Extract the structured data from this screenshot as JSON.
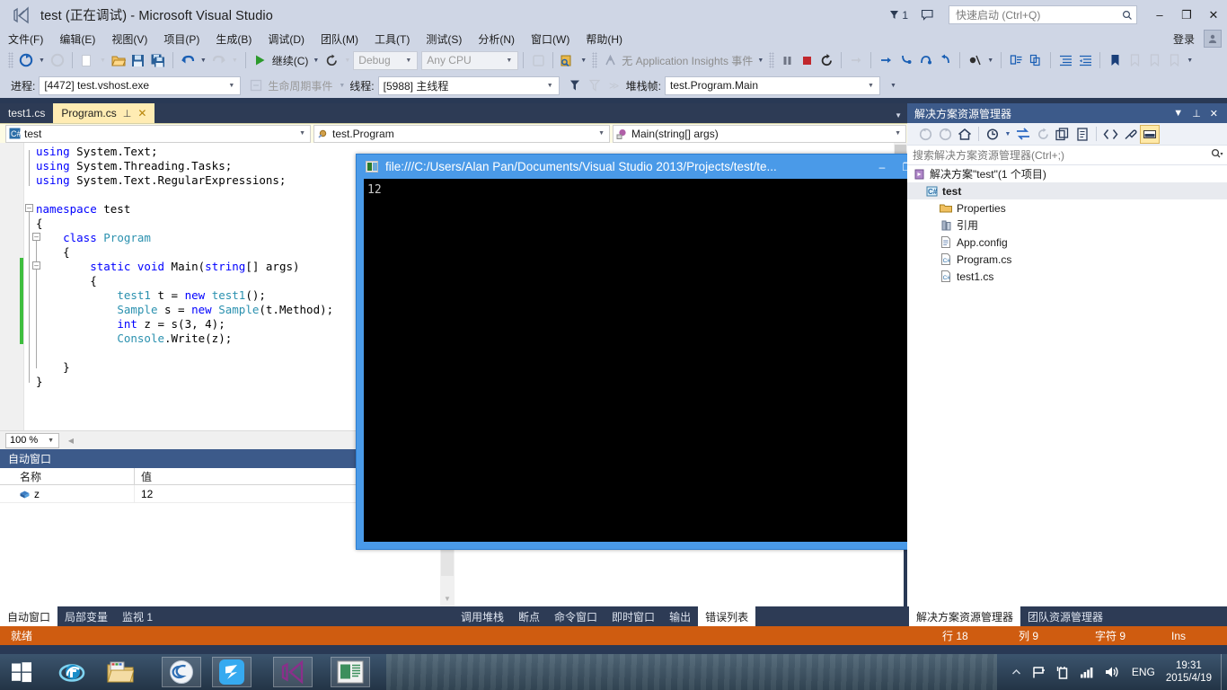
{
  "titlebar": {
    "app_icon": "visual-studio-logo",
    "title": "test (正在调试) - Microsoft Visual Studio",
    "notification_count": "1",
    "quick_launch_placeholder": "快速启动 (Ctrl+Q)",
    "minimize": "–",
    "restore": "❐",
    "close": "✕"
  },
  "menubar": {
    "items": [
      {
        "label": "文件(F)"
      },
      {
        "label": "编辑(E)"
      },
      {
        "label": "视图(V)"
      },
      {
        "label": "项目(P)"
      },
      {
        "label": "生成(B)"
      },
      {
        "label": "调试(D)"
      },
      {
        "label": "团队(M)"
      },
      {
        "label": "工具(T)"
      },
      {
        "label": "测试(S)"
      },
      {
        "label": "分析(N)"
      },
      {
        "label": "窗口(W)"
      },
      {
        "label": "帮助(H)"
      }
    ],
    "signin": "登录"
  },
  "toolbar": {
    "continue_label": "继续(C)",
    "config_value": "Debug",
    "platform_value": "Any CPU",
    "app_insights_label": "无 Application Insights 事件",
    "process_label": "进程:",
    "process_value": "[4472] test.vshost.exe",
    "lifecycle_label": "生命周期事件",
    "thread_label": "线程:",
    "thread_value": "[5988] 主线程",
    "stackframe_label": "堆栈帧:",
    "stackframe_value": "test.Program.Main"
  },
  "doctabs": {
    "tabs": [
      {
        "label": "test1.cs",
        "active": false
      },
      {
        "label": "Program.cs",
        "active": true
      }
    ],
    "pin_glyph": "⊥",
    "close_glyph": "✕"
  },
  "navbar": {
    "project": "test",
    "type": "test.Program",
    "member": "Main(string[] args)"
  },
  "editor": {
    "zoom": "100 %",
    "lines": [
      "using System.Text;",
      "using System.Threading.Tasks;",
      "using System.Text.RegularExpressions;",
      "",
      "namespace test",
      "{",
      "    class Program",
      "    {",
      "        static void Main(string[] args)",
      "        {",
      "            test1 t = new test1();",
      "            Sample s = new Sample(t.Method);",
      "            int z = s(3, 4);",
      "            Console.Write(z);",
      "        }",
      "    }",
      "}"
    ]
  },
  "autos": {
    "title": "自动窗口",
    "columns": [
      "名称",
      "值"
    ],
    "rows": [
      {
        "name": "z",
        "value": "12"
      }
    ]
  },
  "bottom_tabs": {
    "left": [
      {
        "label": "自动窗口",
        "active": true
      },
      {
        "label": "局部变量",
        "active": false
      },
      {
        "label": "监视 1",
        "active": false
      }
    ],
    "middle": [
      {
        "label": "调用堆栈",
        "active": false
      },
      {
        "label": "断点",
        "active": false
      },
      {
        "label": "命令窗口",
        "active": false
      },
      {
        "label": "即时窗口",
        "active": false
      },
      {
        "label": "输出",
        "active": false
      },
      {
        "label": "错误列表",
        "active": true
      }
    ],
    "right": [
      {
        "label": "解决方案资源管理器",
        "active": true
      },
      {
        "label": "团队资源管理器",
        "active": false
      }
    ]
  },
  "statusbar": {
    "ready": "就绪",
    "line": "行 18",
    "column": "列 9",
    "character": "字符 9",
    "insert_mode": "Ins"
  },
  "solution_explorer": {
    "title": "解决方案资源管理器",
    "search_placeholder": "搜索解决方案资源管理器(Ctrl+;)",
    "tree": [
      {
        "label": "解决方案\"test\"(1 个项目)",
        "indent": 0,
        "icon": "solution-icon",
        "selected": false
      },
      {
        "label": "test",
        "indent": 1,
        "icon": "project-icon",
        "selected": true,
        "bold": true
      },
      {
        "label": "Properties",
        "indent": 2,
        "icon": "folder-icon",
        "selected": false
      },
      {
        "label": "引用",
        "indent": 2,
        "icon": "references-icon",
        "selected": false
      },
      {
        "label": "App.config",
        "indent": 2,
        "icon": "config-file-icon",
        "selected": false
      },
      {
        "label": "Program.cs",
        "indent": 2,
        "icon": "csharp-file-icon",
        "selected": false
      },
      {
        "label": "test1.cs",
        "indent": 2,
        "icon": "csharp-file-icon",
        "selected": false
      }
    ]
  },
  "console_window": {
    "title": "file:///C:/Users/Alan Pan/Documents/Visual Studio 2013/Projects/test/te...",
    "output": "12",
    "minimize": "–",
    "maximize": "❐",
    "close": "✕"
  },
  "taskbar": {
    "items": [
      {
        "name": "start-button",
        "glyph": "win"
      },
      {
        "name": "internet-explorer",
        "glyph": "ie"
      },
      {
        "name": "file-explorer",
        "glyph": "explorer"
      },
      {
        "name": "sogou-app",
        "glyph": "sogou",
        "running": true
      },
      {
        "name": "kingsoft-app",
        "glyph": "kingsoft",
        "running": true
      },
      {
        "name": "visual-studio-app",
        "glyph": "vs",
        "running": true
      },
      {
        "name": "console-app",
        "glyph": "console",
        "running": true
      }
    ],
    "language": "ENG",
    "time": "19:31",
    "date": "2015/4/19"
  },
  "colors": {
    "chrome": "#cfd6e5",
    "panel_header": "#3c5a8a",
    "status_debug": "#cf5c10",
    "tab_active": "#ffecb3",
    "accent_blue": "#4a9ae8"
  }
}
